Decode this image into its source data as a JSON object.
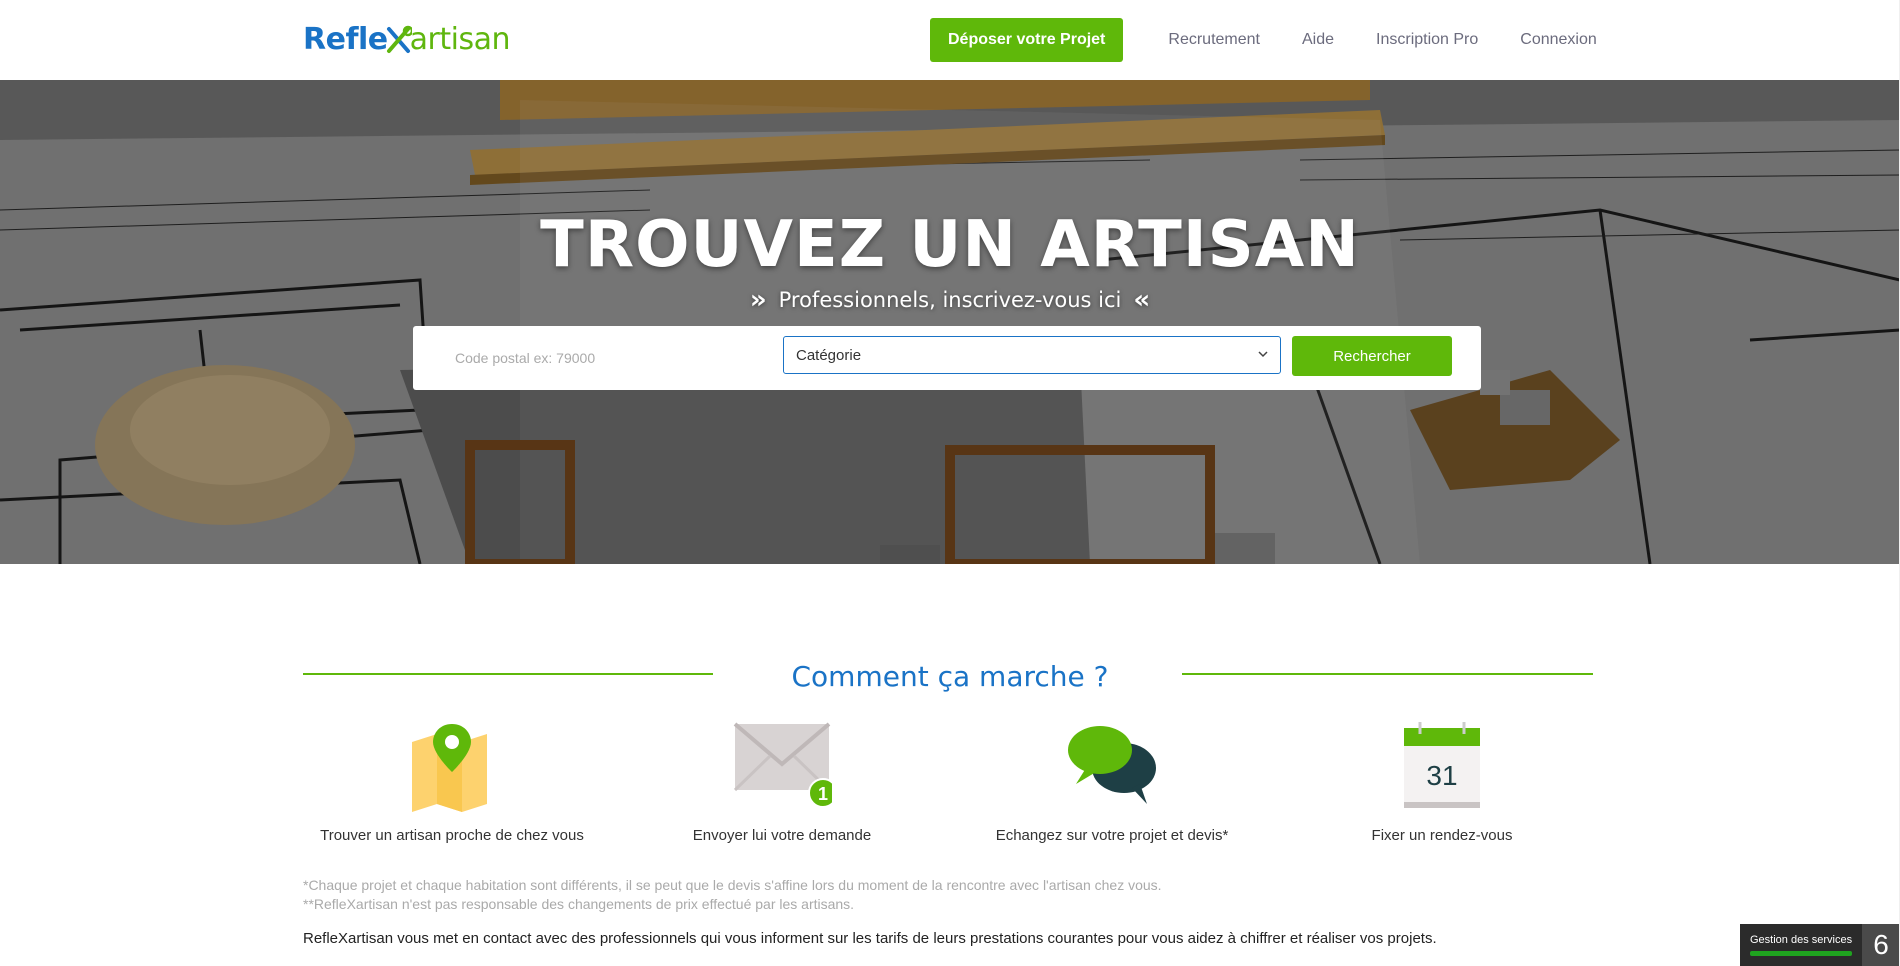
{
  "header": {
    "logo_part1": "Refle",
    "logo_part2": "artisan",
    "cta_label": "Déposer votre Projet",
    "nav": [
      "Recrutement",
      "Aide",
      "Inscription Pro",
      "Connexion"
    ]
  },
  "hero": {
    "title": "TROUVEZ UN ARTISAN",
    "subtitle": "Professionnels, inscrivez-vous ici",
    "left_chevron": "»",
    "right_chevron": "«",
    "postal_placeholder": "Code postal ex: 79000",
    "category_value": "Catégorie",
    "search_button": "Rechercher"
  },
  "how": {
    "title": "Comment ça marche ?",
    "steps": [
      {
        "label": "Trouver un artisan proche de chez vous",
        "icon": "map-pin-icon"
      },
      {
        "label": "Envoyer lui votre demande",
        "icon": "envelope-icon",
        "badge": "1"
      },
      {
        "label": "Echangez sur votre projet et devis*",
        "icon": "chat-bubbles-icon"
      },
      {
        "label": "Fixer un rendez-vous",
        "icon": "calendar-icon",
        "day": "31"
      }
    ],
    "note1": "*Chaque projet et chaque habitation sont différents, il se peut que le devis s'affine lors du moment de la rencontre avec l'artisan chez vous.",
    "note2": "**RefleXartisan n'est pas responsable des changements de prix effectué par les artisans.",
    "description": "RefleXartisan vous met en contact avec des professionnels qui vous informent sur les tarifs de leurs prestations courantes pour vous aidez à chiffrer et réaliser vos projets."
  },
  "widget": {
    "label": "Gestion des services",
    "count": "6"
  },
  "colors": {
    "brand_blue": "#1a73c6",
    "brand_green": "#5fb80a"
  }
}
